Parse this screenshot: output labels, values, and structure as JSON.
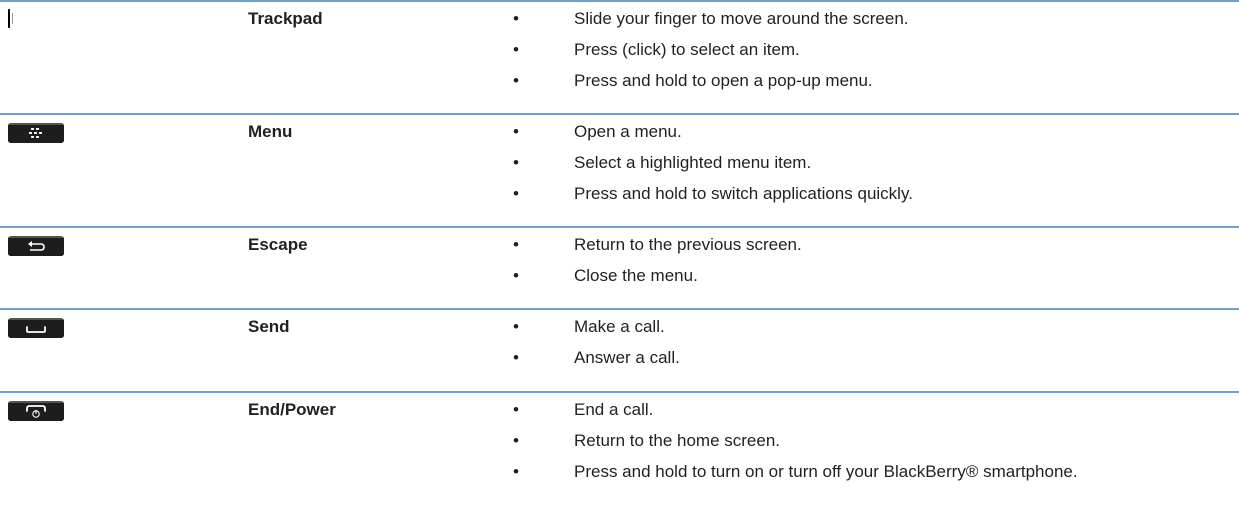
{
  "keys": [
    {
      "icon": "trackpad-icon",
      "label": "Trackpad",
      "actions": [
        "Slide your finger to move around the screen.",
        "Press (click) to select an item.",
        "Press and hold to open a pop-up menu."
      ]
    },
    {
      "icon": "menu-key-icon",
      "label": "Menu",
      "actions": [
        "Open a menu.",
        "Select a highlighted menu item.",
        "Press and hold to switch applications quickly."
      ]
    },
    {
      "icon": "escape-key-icon",
      "label": "Escape",
      "actions": [
        "Return to the previous screen.",
        "Close the menu."
      ]
    },
    {
      "icon": "send-key-icon",
      "label": "Send",
      "actions": [
        "Make a call.",
        "Answer a call."
      ]
    },
    {
      "icon": "end-power-key-icon",
      "label": "End/Power",
      "actions": [
        "End a call.",
        "Return to the home screen.",
        "Press and hold to turn on or turn off your BlackBerry® smartphone."
      ]
    }
  ],
  "bullet": "•",
  "colors": {
    "row_rule": "#6f9fd0",
    "text": "#231f20",
    "key_fill": "#1d1d1d"
  }
}
